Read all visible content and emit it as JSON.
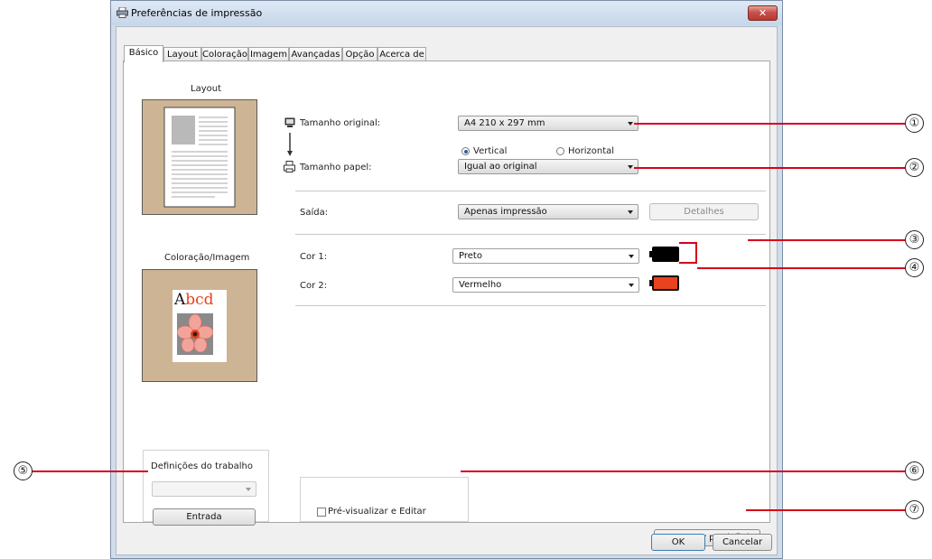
{
  "window": {
    "title": "Preferências de impressão",
    "close_glyph": "✕"
  },
  "tabs": [
    {
      "label": "Básico",
      "active": true
    },
    {
      "label": "Layout"
    },
    {
      "label": "Coloração"
    },
    {
      "label": "Imagem"
    },
    {
      "label": "Avançadas"
    },
    {
      "label": "Opção"
    },
    {
      "label": "Acerca de"
    }
  ],
  "layout_preview": {
    "label": "Layout"
  },
  "color_preview": {
    "label": "Coloração/Imagem",
    "sample_text": "Abcd"
  },
  "form": {
    "original_size_label": "Tamanho original:",
    "original_size_value": "A4 210 x 297 mm",
    "orientation_vertical": "Vertical",
    "orientation_horizontal": "Horizontal",
    "orientation_selected": "Vertical",
    "paper_size_label": "Tamanho papel:",
    "paper_size_value": "Igual ao original",
    "output_label": "Saída:",
    "output_value": "Apenas impressão",
    "details_button": "Detalhes",
    "color1_label": "Cor 1:",
    "color1_value": "Preto",
    "color2_label": "Cor 2:",
    "color2_value": "Vermelho"
  },
  "colors": {
    "color1": "#000000",
    "color2": "#e8421f",
    "callout": "#d6001c"
  },
  "job_settings": {
    "label": "Definições do trabalho",
    "select_value": "",
    "entry_button": "Entrada"
  },
  "preview_edit": {
    "label": "Pré-visualizar e Editar",
    "checked": false
  },
  "restore_button": "Restaurar predefini.",
  "footer": {
    "ok": "OK",
    "cancel": "Cancelar"
  },
  "callouts": [
    "①",
    "②",
    "③",
    "④",
    "⑤",
    "⑥",
    "⑦"
  ]
}
